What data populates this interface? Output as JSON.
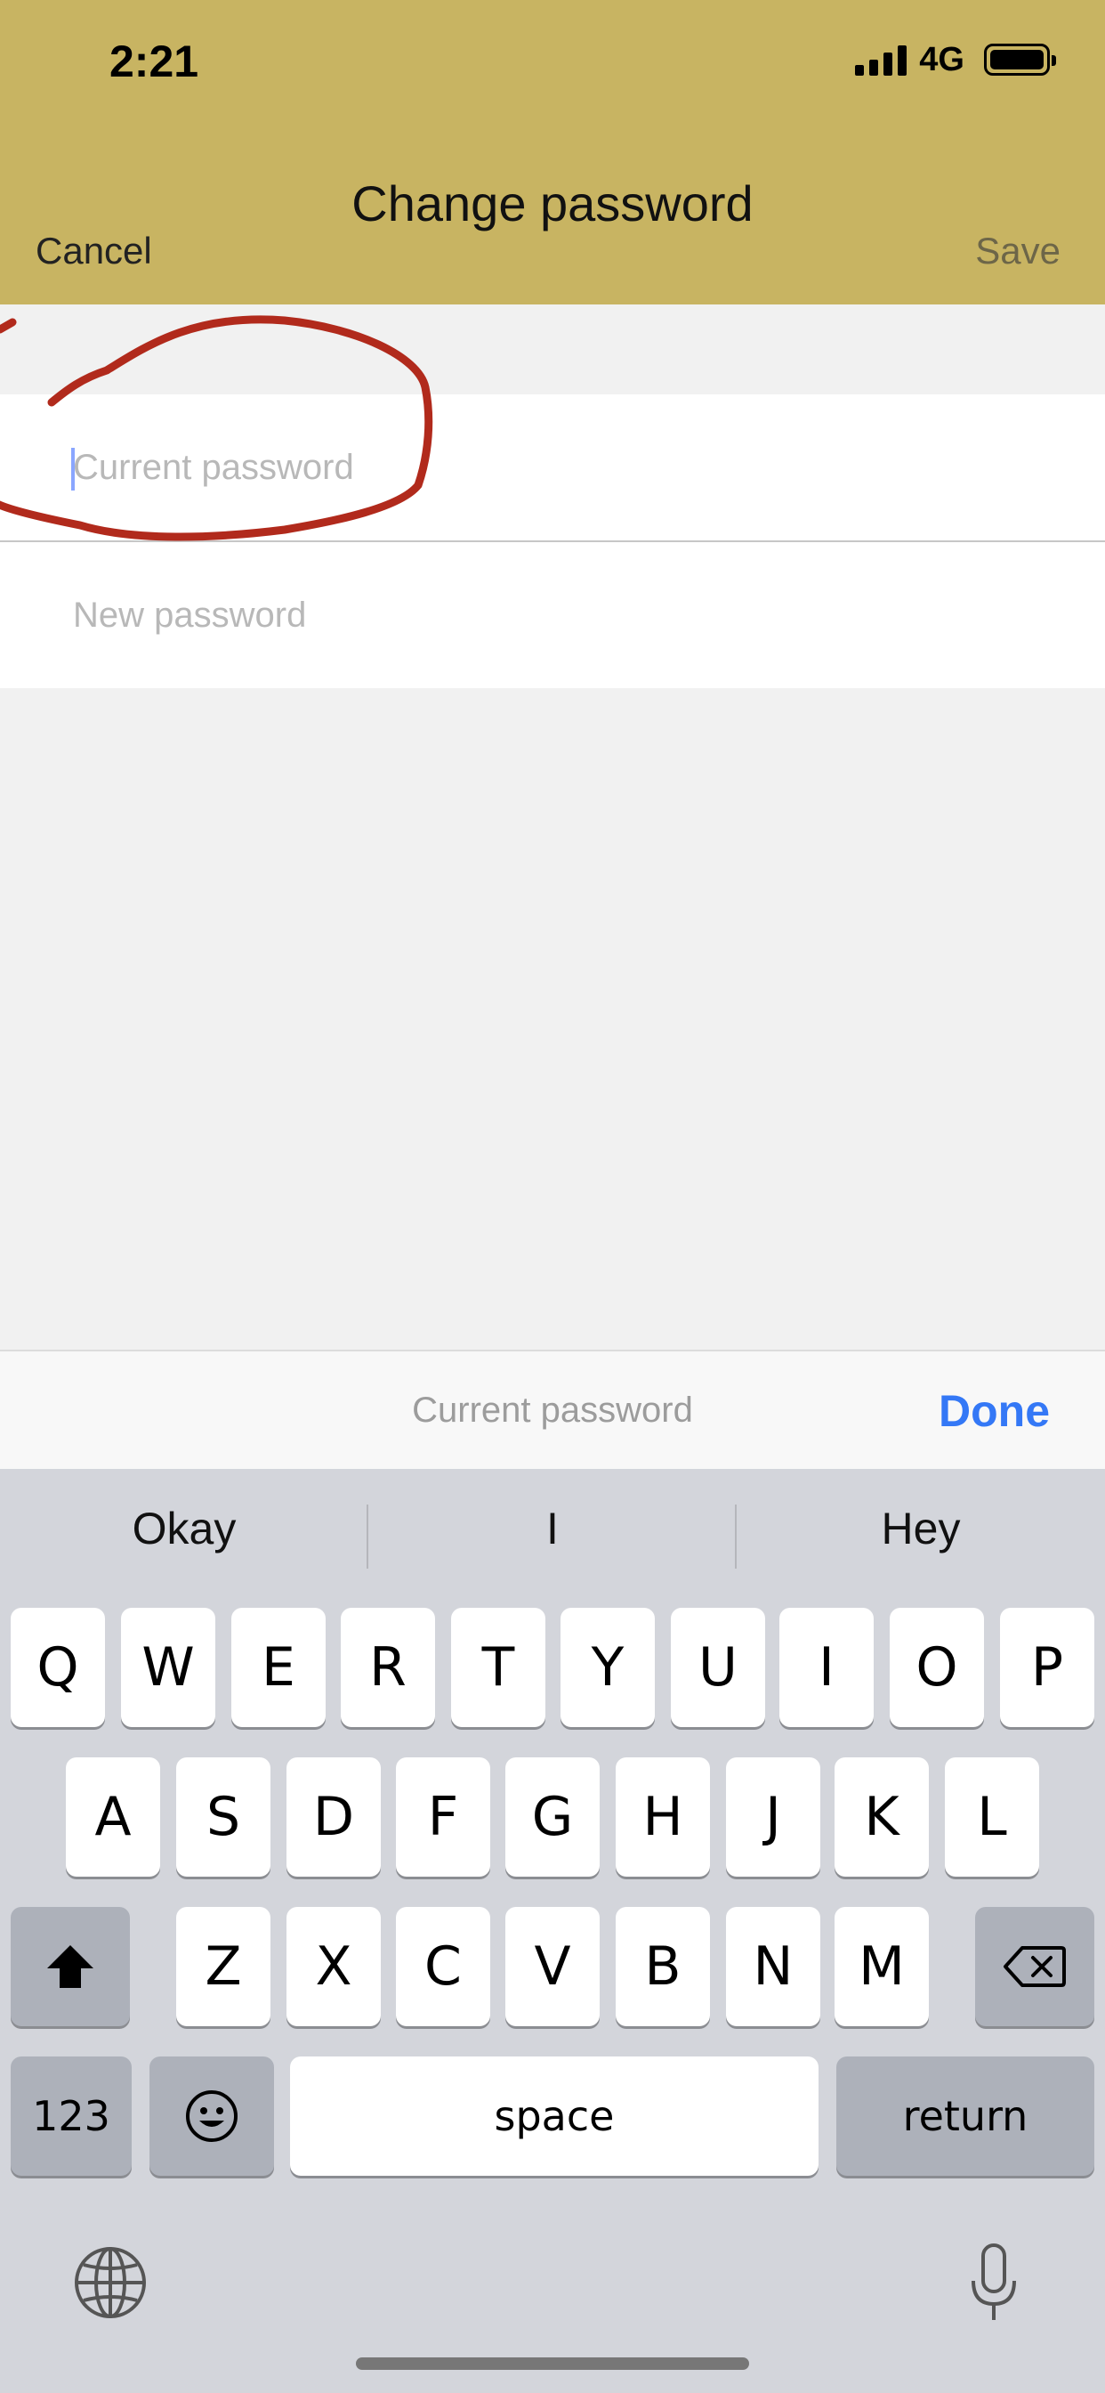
{
  "status_bar": {
    "time": "2:21",
    "network": "4G"
  },
  "nav": {
    "title": "Change password",
    "cancel_label": "Cancel",
    "save_label": "Save"
  },
  "form": {
    "current_password_placeholder": "Current password",
    "new_password_placeholder": "New password"
  },
  "accessory_bar": {
    "label": "Current password",
    "done_label": "Done"
  },
  "keyboard": {
    "suggestions": [
      "Okay",
      "I",
      "Hey"
    ],
    "row1": [
      "Q",
      "W",
      "E",
      "R",
      "T",
      "Y",
      "U",
      "I",
      "O",
      "P"
    ],
    "row2": [
      "A",
      "S",
      "D",
      "F",
      "G",
      "H",
      "J",
      "K",
      "L"
    ],
    "row3": [
      "Z",
      "X",
      "C",
      "V",
      "B",
      "N",
      "M"
    ],
    "numbers_label": "123",
    "space_label": "space",
    "return_label": "return"
  },
  "colors": {
    "header": "#c8b462",
    "annotation": "#b12a1c",
    "done": "#3478f6"
  },
  "icons": [
    "signal-icon",
    "battery-icon",
    "shift-icon",
    "delete-icon",
    "emoji-icon",
    "globe-icon",
    "microphone-icon"
  ]
}
